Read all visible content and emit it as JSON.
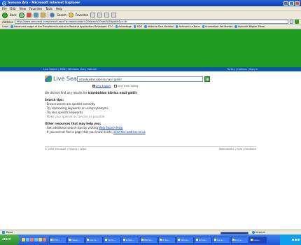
{
  "window": {
    "title": "Sonuna Ara - Microsoft Internet Explorer"
  },
  "menu": [
    "File",
    "Edit",
    "View",
    "Favorites",
    "Tools",
    "Help"
  ],
  "toolbar": {
    "back": "Back",
    "search": "Search",
    "favorites": "Favorites"
  },
  "address": {
    "label": "Address",
    "url": "http://www.sonunera.com/default.aspx?q=istanbuldan%20kbrsa%20nasl%20gidilir&cc=tr"
  },
  "links": {
    "label": "Links",
    "items": [
      "Advanced usage of the Transferred control in Borland Application Developer 07.0",
      "Advantage",
      "ADG",
      "Akdeniz Gezi Merkezi",
      "Akhisarli ve Benz",
      "Anamalkan Pet Market",
      "Asknolik Bilgiler Sitesi"
    ]
  },
  "msn_nav": {
    "left": "Live Search  |  MSN  |  Windows Live  |  Hotmail",
    "right": "Turkey  |  Options  |  Sign in"
  },
  "search": {
    "logo": "Live Search",
    "query": "istanbuldan kibrisa nasil gidilir",
    "option_english": "Only English",
    "option_turkey": "Only from Turkey"
  },
  "results": {
    "notfound_prefix": "We did not find any results for",
    "notfound_query": "istanbuldan kibrisa nasil gidilir",
    "tips_heading": "Search tips:",
    "tips": [
      "- Ensure words are spelled correctly.",
      "- Try rephrasing keywords or using synonyms.",
      "- Try less specific keywords.",
      "- Make your queries as concise as possible."
    ],
    "other_heading": "Other resources that may help you:",
    "other_line1_prefix": "- Get additional search tips by visiting",
    "other_line1_link": "Web Search Help",
    "other_line2_prefix": "- If you cannot find a page that you know exists,",
    "other_line2_link": "send the address to us"
  },
  "footer": {
    "left": "© 2008 Microsoft  |  Privacy  |  Legal",
    "right": "Webmasters  |  Help  |  Feedback"
  },
  "status": {
    "text": "Done",
    "zone": "Internet",
    "progress": 1.0
  },
  "taskbar": {
    "start": "start",
    "tasks": [
      "TEST...",
      "Mesaj...",
      "Can G...",
      "FLITS...",
      "Kullan...",
      "IBM W...",
      "W Sp...",
      "Micros...",
      "Windo...",
      "Gece...",
      "Imi_e...",
      "Sonu..."
    ],
    "active_index": 11
  }
}
